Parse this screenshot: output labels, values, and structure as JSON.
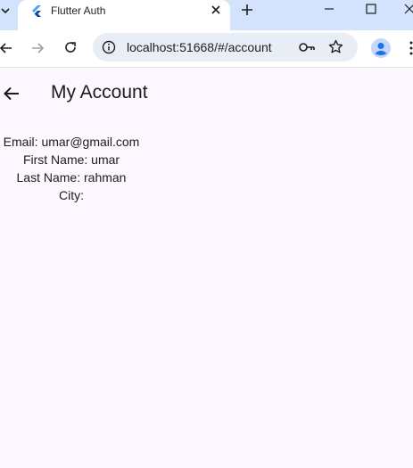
{
  "browser": {
    "tab": {
      "title": "Flutter Auth",
      "favicon": "flutter-icon"
    },
    "address_bar": {
      "url": "localhost:51668/#/account"
    },
    "icons": {
      "tab_dropdown": "chevron-down-icon",
      "close_tab": "close-icon",
      "new_tab": "plus-icon",
      "back": "arrow-left-icon",
      "forward": "arrow-right-icon",
      "reload": "reload-icon",
      "site_info": "info-icon",
      "passwords": "key-icon",
      "bookmark": "star-icon",
      "profile": "profile-icon",
      "minimize": "minimize-icon",
      "maximize": "maximize-icon",
      "close_window": "close-icon"
    },
    "colors": {
      "tabstrip": "#d3e3fd",
      "omnibox": "#e9eef6",
      "profile_accent": "#1a73e8"
    }
  },
  "app": {
    "appbar": {
      "title": "My Account",
      "back_icon": "arrow-left-icon"
    },
    "account": {
      "email": "Email: umar@gmail.com",
      "first_name": "First Name: umar",
      "last_name": "Last Name: rahman",
      "city": "City:"
    },
    "colors": {
      "background": "#fdf7ff",
      "text": "#1d1b20"
    }
  }
}
